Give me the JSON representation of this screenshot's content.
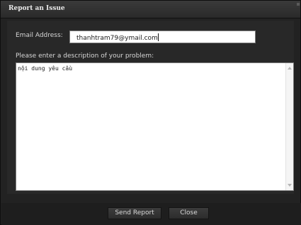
{
  "dialog": {
    "title": "Report an Issue"
  },
  "form": {
    "email_label": "Email Address:",
    "email_value": "thanhtram79@ymail.com",
    "description_label": "Please enter a description of your problem:",
    "description_value": "nội dung yêu cầu"
  },
  "buttons": {
    "send_label": "Send Report",
    "close_label": "Close"
  },
  "icons": {
    "scroll_up": "scroll-up-arrow-icon",
    "scroll_down": "scroll-down-arrow-icon"
  }
}
